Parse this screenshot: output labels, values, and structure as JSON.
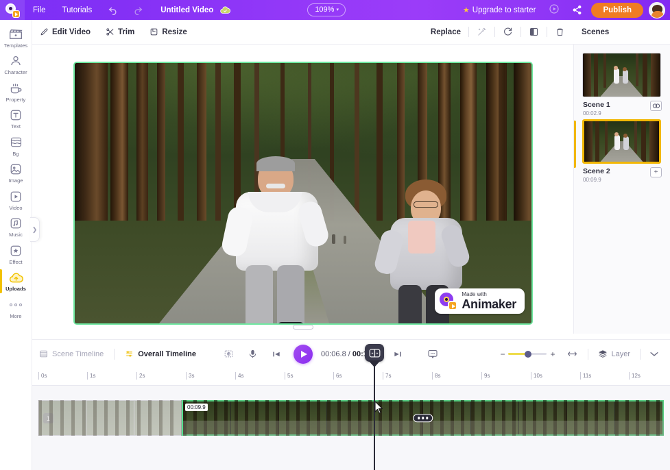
{
  "topbar": {
    "logo": "animaker-logo",
    "menus": [
      {
        "label": "File",
        "name": "menu-file"
      },
      {
        "label": "Tutorials",
        "name": "menu-tutorials"
      }
    ],
    "undo_icon": "undo-icon",
    "redo_icon": "redo-icon",
    "project_title": "Untitled Video",
    "save_status_icon": "cloud-saved-icon",
    "zoom_level": "109%",
    "zoom_caret": "▾",
    "upgrade_label": "Upgrade to starter",
    "upgrade_star": "★",
    "preview_icon": "play-preview-icon",
    "share_icon": "share-icon",
    "publish_label": "Publish",
    "avatar": "user-avatar"
  },
  "sidebar": {
    "items": [
      {
        "label": "Templates",
        "icon": "templates-icon"
      },
      {
        "label": "Character",
        "icon": "character-icon"
      },
      {
        "label": "Property",
        "icon": "property-icon"
      },
      {
        "label": "Text",
        "icon": "text-icon"
      },
      {
        "label": "Bg",
        "icon": "background-icon"
      },
      {
        "label": "Image",
        "icon": "image-icon"
      },
      {
        "label": "Video",
        "icon": "video-icon"
      },
      {
        "label": "Music",
        "icon": "music-icon"
      },
      {
        "label": "Effect",
        "icon": "effect-icon"
      },
      {
        "label": "Uploads",
        "icon": "uploads-icon",
        "active": true
      },
      {
        "label": "More",
        "icon": "more-dots-icon"
      }
    ],
    "collapse_icon": "chevron-right-icon"
  },
  "subtoolbar": {
    "edit_video_label": "Edit Video",
    "edit_video_icon": "pencil-icon",
    "trim_label": "Trim",
    "trim_icon": "scissors-icon",
    "resize_label": "Resize",
    "resize_icon": "crop-icon",
    "replace_label": "Replace",
    "enhance_icon": "magic-wand-icon",
    "rotate_icon": "rotate-icon",
    "flip_icon": "flip-icon",
    "delete_icon": "trash-icon",
    "scenes_panel_title": "Scenes"
  },
  "stage": {
    "preview_alt": "Two people jogging on a forest path",
    "selection_color": "#6ee7a0",
    "watermark": {
      "line1": "Made with",
      "line2": "Animaker",
      "logo": "animaker-logo"
    },
    "resize_handle": "stage-resize-handle"
  },
  "scenes": [
    {
      "name": "Scene 1",
      "duration": "00:02.9",
      "action_icon": "link-scenes-icon",
      "selected": false
    },
    {
      "name": "Scene 2",
      "duration": "00:09.9",
      "action_icon": "add-scene-icon",
      "selected": true
    }
  ],
  "timeline": {
    "scene_timeline_label": "Scene Timeline",
    "scene_timeline_icon": "scene-timeline-icon",
    "overall_timeline_label": "Overall Timeline",
    "overall_timeline_icon": "overall-timeline-icon",
    "focus_icon": "focus-icon",
    "mic_icon": "microphone-icon",
    "prev_frame_icon": "previous-frame-icon",
    "play_icon": "play-icon",
    "next_frame_icon": "next-frame-icon",
    "subtitle_icon": "subtitle-icon",
    "current_time": "00:06.8",
    "time_separator": " / ",
    "total_time": "00:12.8",
    "zoom_out_icon": "−",
    "zoom_in_icon": "+",
    "fit_icon": "fit-to-screen-icon",
    "layer_label": "Layer",
    "layer_icon": "layers-icon",
    "expand_icon": "chevron-down-icon",
    "ruler_ticks": [
      "0s",
      "1s",
      "2s",
      "3s",
      "4s",
      "5s",
      "6s",
      "7s",
      "8s",
      "9s",
      "10s",
      "11s",
      "12s"
    ],
    "scene1_clip": {
      "badge": "1",
      "frames": 3,
      "active": false
    },
    "scene2_clip": {
      "duration_label": "00:09.9",
      "frames": 9,
      "active": true,
      "menu_icon": "clip-more-icon"
    },
    "playhead_icon": "split-playhead-icon",
    "cursor": "mouse-pointer"
  }
}
